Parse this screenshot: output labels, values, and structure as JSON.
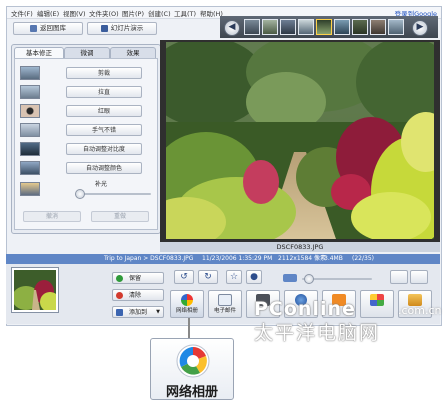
{
  "menubar": {
    "items": [
      "文件(F)",
      "编辑(E)",
      "视图(V)",
      "文件夹(O)",
      "图片(P)",
      "创建(C)",
      "工具(T)",
      "帮助(H)"
    ],
    "signin": "登录到Google"
  },
  "left_toolbar": {
    "back_label": "返回图库",
    "slideshow_label": "幻灯片演示"
  },
  "tabs": [
    "基本修正",
    "微调",
    "效果"
  ],
  "fixes": [
    {
      "label": "剪裁"
    },
    {
      "label": "拉直"
    },
    {
      "label": "红眼"
    },
    {
      "label": "手气不错"
    },
    {
      "label": "自动调整对比度"
    },
    {
      "label": "自动调整颜色"
    }
  ],
  "fill_light": {
    "label": "补光",
    "value": 0.0
  },
  "undo_label": "撤消",
  "redo_label": "重做",
  "viewer": {
    "caption": "DSCF0833.JPG",
    "prev_icon": "left-arrow-icon",
    "next_icon": "right-arrow-icon"
  },
  "status": {
    "album": "Trip to Japan > DSCF0833.JPG",
    "date": "11/23/2006 1:35:29 PM",
    "dimensions": "2112x1584 像素",
    "size": "3.4MB",
    "count": "(22/35)"
  },
  "tray": {
    "hold_label": "保留",
    "clear_label": "清除",
    "add_label": "添加到"
  },
  "actions": [
    {
      "label": "网络相册",
      "icon": "web-album-icon"
    },
    {
      "label": "电子邮件",
      "icon": "email-icon"
    },
    {
      "label": "",
      "icon": "print-icon"
    },
    {
      "label": "",
      "icon": "order-prints-icon"
    },
    {
      "label": "",
      "icon": "blogger-icon"
    },
    {
      "label": "",
      "icon": "collage-icon"
    },
    {
      "label": "",
      "icon": "export-icon"
    }
  ],
  "callout": {
    "label": "网络相册"
  },
  "watermark": {
    "brand": "PConline",
    "domain": ".com.cn",
    "tagline": "太平洋电脑网"
  },
  "colors": {
    "accent": "#5f86c6",
    "window_bg": "#eef1f6",
    "filmstrip": "#4a535e"
  }
}
